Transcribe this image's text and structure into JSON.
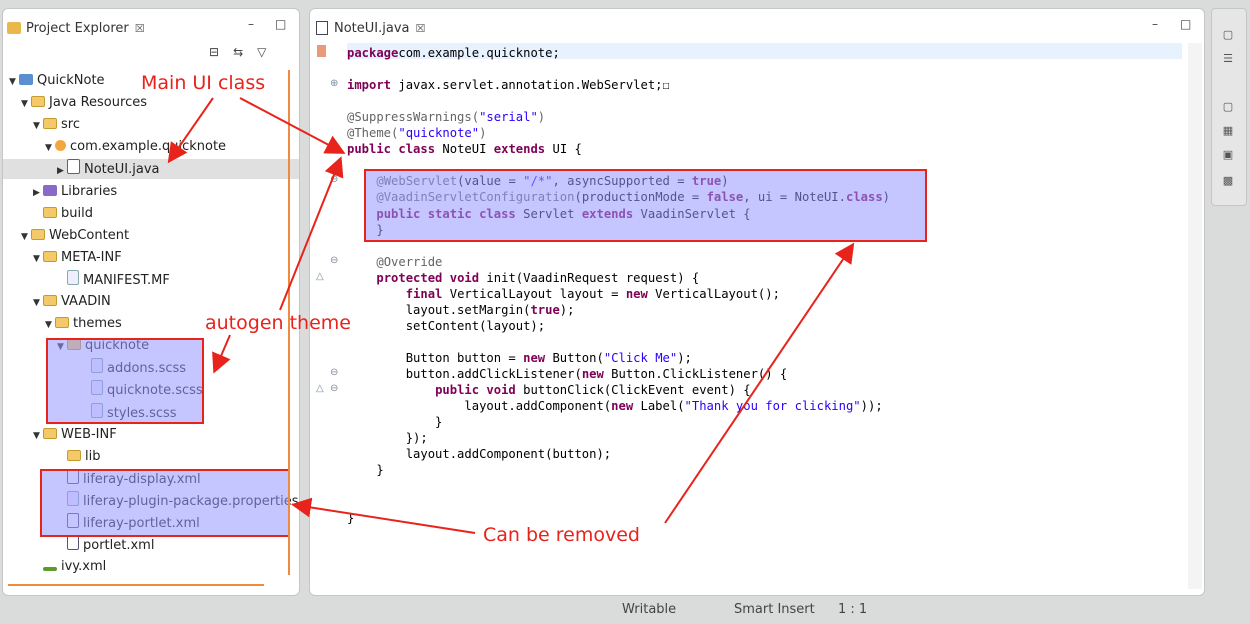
{
  "project_explorer": {
    "tab_label": "Project Explorer",
    "tab_close": "☒",
    "minimize": "–",
    "maximize": "□",
    "toolbar": [
      "⊟",
      "⇆",
      "▽"
    ],
    "tree": [
      {
        "label": "QuickNote",
        "arrow": "▼",
        "icon": "project"
      },
      {
        "label": "Java Resources",
        "arrow": "▼",
        "icon": "folder"
      },
      {
        "label": "src",
        "arrow": "▼",
        "icon": "folder"
      },
      {
        "label": "com.example.quicknote",
        "arrow": "▼",
        "icon": "pkg"
      },
      {
        "label": "NoteUI.java",
        "arrow": "▶",
        "icon": "java"
      },
      {
        "label": "Libraries",
        "arrow": "▶",
        "icon": "lib"
      },
      {
        "label": "build",
        "arrow": "",
        "icon": "folder"
      },
      {
        "label": "WebContent",
        "arrow": "▼",
        "icon": "folder"
      },
      {
        "label": "META-INF",
        "arrow": "▼",
        "icon": "folder"
      },
      {
        "label": "MANIFEST.MF",
        "arrow": "",
        "icon": "file"
      },
      {
        "label": "VAADIN",
        "arrow": "▼",
        "icon": "folder"
      },
      {
        "label": "themes",
        "arrow": "▼",
        "icon": "folder"
      },
      {
        "label": "quicknote",
        "arrow": "▼",
        "icon": "folder"
      },
      {
        "label": "addons.scss",
        "arrow": "",
        "icon": "file"
      },
      {
        "label": "quicknote.scss",
        "arrow": "",
        "icon": "file"
      },
      {
        "label": "styles.scss",
        "arrow": "",
        "icon": "file"
      },
      {
        "label": "WEB-INF",
        "arrow": "▼",
        "icon": "folder"
      },
      {
        "label": "lib",
        "arrow": "",
        "icon": "folder"
      },
      {
        "label": "liferay-display.xml",
        "arrow": "",
        "icon": "xml"
      },
      {
        "label": "liferay-plugin-package.properties",
        "arrow": "",
        "icon": "file"
      },
      {
        "label": "liferay-portlet.xml",
        "arrow": "",
        "icon": "xml"
      },
      {
        "label": "portlet.xml",
        "arrow": "",
        "icon": "xml"
      },
      {
        "label": "ivy.xml",
        "arrow": "",
        "icon": "ivy"
      }
    ]
  },
  "editor": {
    "tab_label": "NoteUI.java",
    "tab_close": "☒",
    "minimize": "–",
    "maximize": "□",
    "lines": [
      [
        [
          "kw",
          "package"
        ],
        [
          "",
          "com.example.quicknote;"
        ]
      ],
      [],
      [
        [
          "kw",
          "import"
        ],
        [
          "",
          " javax.servlet.annotation.WebServlet;☐"
        ]
      ],
      [],
      [
        [
          "ann",
          "@SuppressWarnings("
        ],
        [
          "str",
          "\"serial\""
        ],
        [
          "ann",
          ")"
        ]
      ],
      [
        [
          "ann",
          "@Theme("
        ],
        [
          "str",
          "\"quicknote\""
        ],
        [
          "ann",
          ")"
        ]
      ],
      [
        [
          "kw",
          "public class"
        ],
        [
          "",
          " NoteUI "
        ],
        [
          "kw",
          "extends"
        ],
        [
          "",
          " UI {"
        ]
      ],
      [],
      [
        [
          "",
          "    "
        ],
        [
          "ann",
          "@WebServlet"
        ],
        [
          "",
          "(value = "
        ],
        [
          "str",
          "\"/*\""
        ],
        [
          "",
          ", asyncSupported = "
        ],
        [
          "kw",
          "true"
        ],
        [
          "",
          ")"
        ]
      ],
      [
        [
          "",
          "    "
        ],
        [
          "ann",
          "@VaadinServletConfiguration"
        ],
        [
          "",
          "(productionMode = "
        ],
        [
          "kw",
          "false"
        ],
        [
          "",
          ", ui = NoteUI."
        ],
        [
          "kw",
          "class"
        ],
        [
          "",
          ")"
        ]
      ],
      [
        [
          "",
          "    "
        ],
        [
          "kw",
          "public static class"
        ],
        [
          "",
          " Servlet "
        ],
        [
          "kw",
          "extends"
        ],
        [
          "",
          " VaadinServlet {"
        ]
      ],
      [
        [
          "",
          "    }"
        ]
      ],
      [],
      [
        [
          "",
          "    "
        ],
        [
          "ann",
          "@Override"
        ]
      ],
      [
        [
          "",
          "    "
        ],
        [
          "kw",
          "protected void"
        ],
        [
          "",
          " init(VaadinRequest request) {"
        ]
      ],
      [
        [
          "",
          "        "
        ],
        [
          "kw",
          "final"
        ],
        [
          "",
          " VerticalLayout layout = "
        ],
        [
          "kw",
          "new"
        ],
        [
          "",
          " VerticalLayout();"
        ]
      ],
      [
        [
          "",
          "        layout.setMargin("
        ],
        [
          "kw",
          "true"
        ],
        [
          "",
          ");"
        ]
      ],
      [
        [
          "",
          "        setContent(layout);"
        ]
      ],
      [],
      [
        [
          "",
          "        Button button = "
        ],
        [
          "kw",
          "new"
        ],
        [
          "",
          " Button("
        ],
        [
          "str",
          "\"Click Me\""
        ],
        [
          "",
          ");"
        ]
      ],
      [
        [
          "",
          "        button.addClickListener("
        ],
        [
          "kw",
          "new"
        ],
        [
          "",
          " Button.ClickListener() {"
        ]
      ],
      [
        [
          "",
          "            "
        ],
        [
          "kw",
          "public void"
        ],
        [
          "",
          " buttonClick(ClickEvent event) {"
        ]
      ],
      [
        [
          "",
          "                layout.addComponent("
        ],
        [
          "kw",
          "new"
        ],
        [
          "",
          " Label("
        ],
        [
          "str",
          "\"Thank you for clicking\""
        ],
        [
          "",
          "));"
        ]
      ],
      [
        [
          "",
          "            }"
        ]
      ],
      [
        [
          "",
          "        });"
        ]
      ],
      [
        [
          "",
          "        layout.addComponent(button);"
        ]
      ],
      [
        [
          "",
          "    }"
        ]
      ],
      [],
      [],
      [
        [
          "",
          "}"
        ]
      ]
    ]
  },
  "status_bar": {
    "mode": "Writable",
    "insert": "Smart Insert",
    "position": "1 : 1"
  },
  "annotations": {
    "main_ui": "Main UI class",
    "theme": "autogen theme",
    "removable": "Can be removed"
  },
  "colors": {
    "highlight": "#9696ff",
    "annotation": "#e8231c",
    "keyword": "#7f0055",
    "string": "#2a00ff"
  }
}
